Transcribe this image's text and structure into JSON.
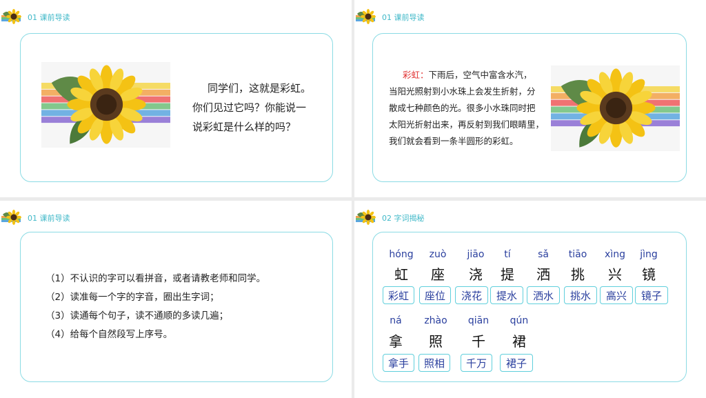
{
  "slides": [
    {
      "header": "01  课前导读",
      "text_lines": [
        "同学们，这就是彩虹。",
        "你们见过它吗？你能说一",
        "说彩虹是什么样的吗？"
      ]
    },
    {
      "header": "01  课前导读",
      "highlight": "彩虹：",
      "text_first": "下雨后，空气中富含水汽，",
      "text_lines": [
        "当阳光照射到小水珠上会发生折射，分",
        "散成七种颜色的光。很多小水珠同时把",
        "太阳光折射出来，再反射到我们眼睛里，",
        "我们就会看到一条半圆形的彩虹。"
      ]
    },
    {
      "header": "01  课前导读",
      "items": [
        "（1）不认识的字可以看拼音，或者请教老师和同学。",
        "（2）读准每一个字的字音，圈出生字词；",
        "（3）读通每个句子，读不通顺的多读几遍；",
        "（4）给每个自然段写上序号。"
      ]
    },
    {
      "header": "02  字词揭秘",
      "row1": [
        {
          "pinyin": "hóng",
          "hanzi": "虹",
          "word": "彩虹"
        },
        {
          "pinyin": "zuò",
          "hanzi": "座",
          "word": "座位"
        },
        {
          "pinyin": "jiāo",
          "hanzi": "浇",
          "word": "浇花"
        },
        {
          "pinyin": "tí",
          "hanzi": "提",
          "word": "提水"
        },
        {
          "pinyin": "sǎ",
          "hanzi": "洒",
          "word": "洒水"
        },
        {
          "pinyin": "tiāo",
          "hanzi": "挑",
          "word": "挑水"
        },
        {
          "pinyin": "xìng",
          "hanzi": "兴",
          "word": "高兴"
        },
        {
          "pinyin": "jìng",
          "hanzi": "镜",
          "word": "镜子"
        }
      ],
      "row2": [
        {
          "pinyin": "ná",
          "hanzi": "拿",
          "word": "拿手"
        },
        {
          "pinyin": "zhào",
          "hanzi": "照",
          "word": "照相"
        },
        {
          "pinyin": "qiān",
          "hanzi": "千",
          "word": "千万"
        },
        {
          "pinyin": "qún",
          "hanzi": "裙",
          "word": "裙子"
        }
      ]
    }
  ]
}
